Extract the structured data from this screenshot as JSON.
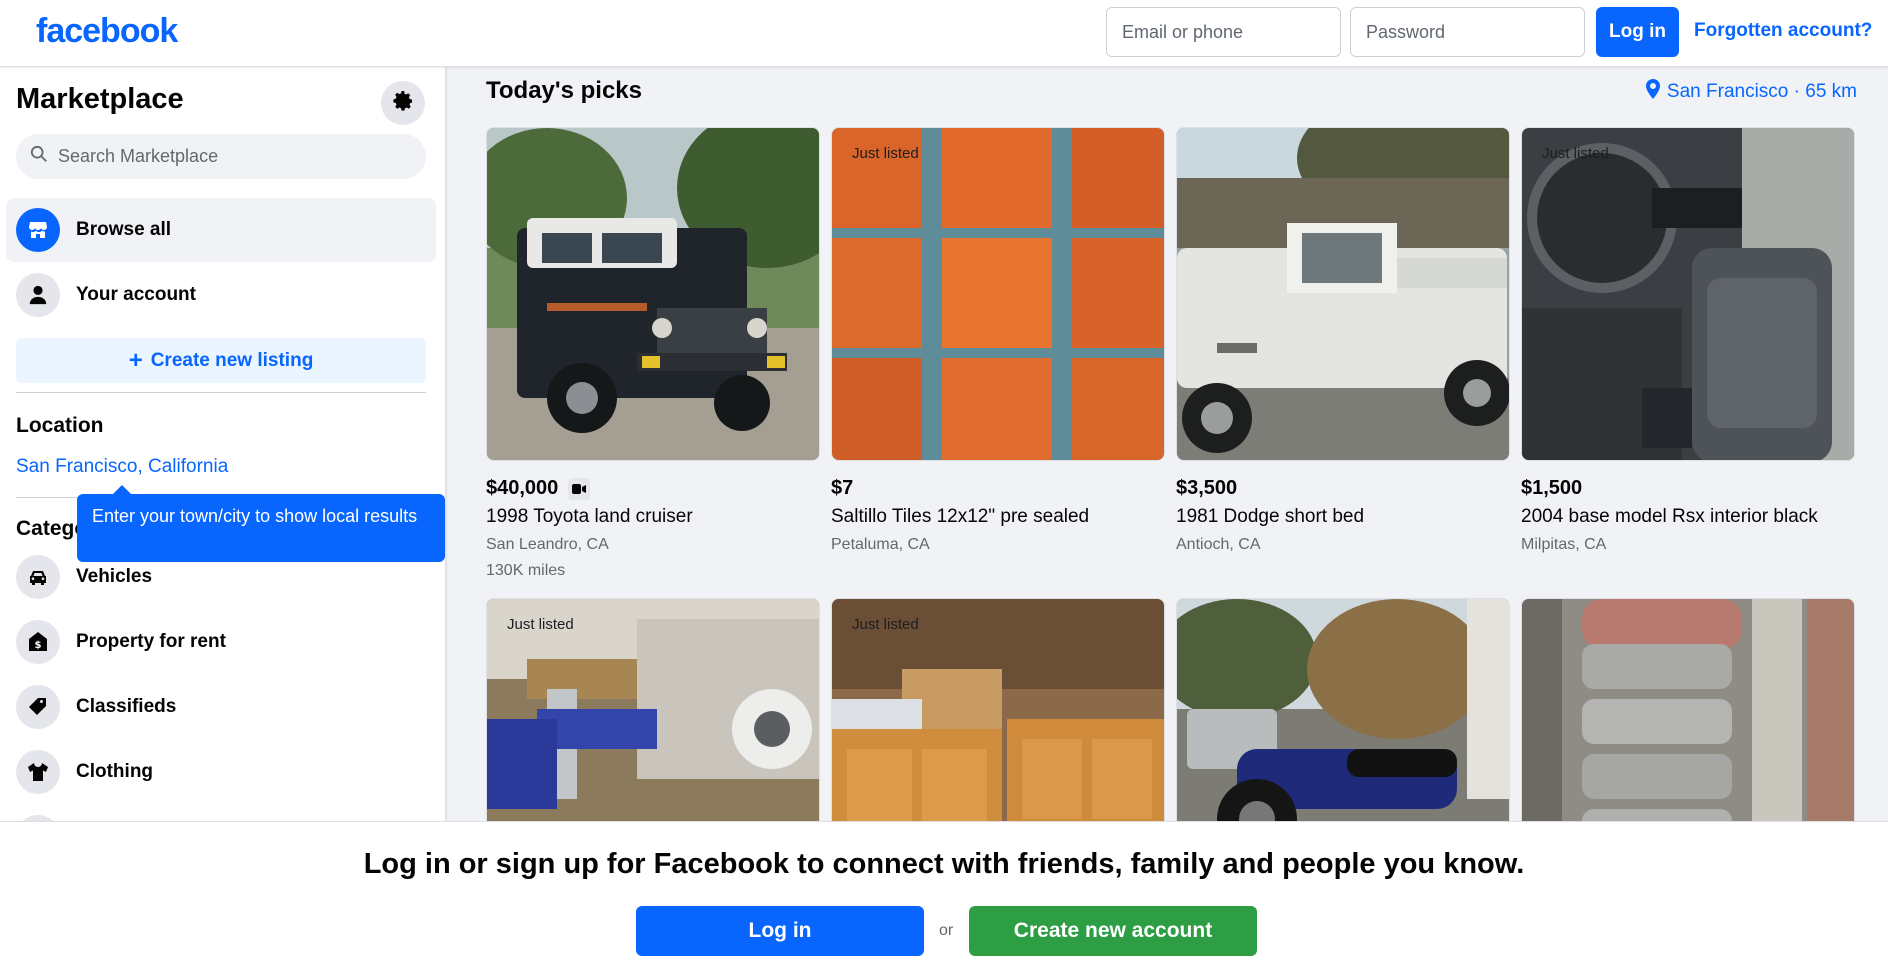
{
  "header": {
    "logo": "facebook",
    "email_placeholder": "Email or phone",
    "password_placeholder": "Password",
    "login_label": "Log in",
    "forgot_label": "Forgotten account?"
  },
  "sidebar": {
    "title": "Marketplace",
    "search_placeholder": "Search Marketplace",
    "nav": [
      {
        "label": "Browse all",
        "icon": "storefront-icon"
      },
      {
        "label": "Your account",
        "icon": "person-icon"
      }
    ],
    "create_label": "Create new listing",
    "location_title": "Location",
    "location_value": "San Francisco, California",
    "categories_title": "Categories",
    "tooltip": "Enter your town/city to show local results",
    "categories": [
      {
        "label": "Vehicles",
        "icon": "car-icon"
      },
      {
        "label": "Property for rent",
        "icon": "house-dollar-icon"
      },
      {
        "label": "Classifieds",
        "icon": "tag-icon"
      },
      {
        "label": "Clothing",
        "icon": "shirt-icon"
      }
    ]
  },
  "main": {
    "title": "Today's picks",
    "location": "San Francisco · 65 km",
    "just_listed_label": "Just listed",
    "listings": [
      {
        "price": "$40,000",
        "title": "1998 Toyota land cruiser",
        "location": "San Leandro, CA",
        "extra": "130K miles",
        "just_listed": false,
        "has_video": true
      },
      {
        "price": "$7",
        "title": "Saltillo Tiles 12x12\" pre sealed",
        "location": "Petaluma, CA",
        "just_listed": true,
        "has_video": false
      },
      {
        "price": "$3,500",
        "title": "1981 Dodge short bed",
        "location": "Antioch, CA",
        "just_listed": false,
        "has_video": false
      },
      {
        "price": "$1,500",
        "title": "2004 base model Rsx interior black",
        "location": "Milpitas, CA",
        "just_listed": true,
        "has_video": false
      },
      {
        "just_listed": true
      },
      {
        "just_listed": true
      },
      {
        "just_listed": false
      },
      {
        "just_listed": false
      }
    ]
  },
  "bottom": {
    "text": "Log in or sign up for Facebook to connect with friends, family and people you know.",
    "login_label": "Log in",
    "or_label": "or",
    "create_label": "Create new account"
  },
  "colors": {
    "brand_blue": "#0866ff",
    "green": "#2e9e44",
    "background": "#f0f2f5"
  }
}
